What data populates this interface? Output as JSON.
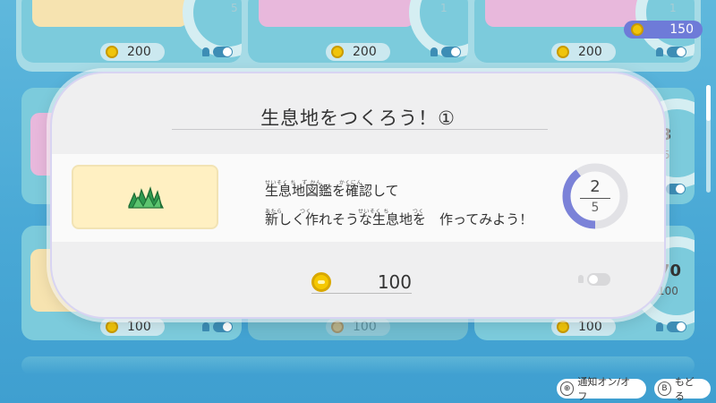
{
  "header": {
    "coin_balance": "150"
  },
  "background_cards": [
    {
      "reward": "200",
      "progress_max": "5"
    },
    {
      "reward": "200",
      "progress_max": "1"
    },
    {
      "reward": "200",
      "progress_max": "1"
    },
    {
      "progress_cur": "3",
      "progress_max": "5"
    },
    {
      "progress_cur": "70",
      "progress_max": "100"
    },
    {
      "reward": "100"
    },
    {
      "reward": "100"
    },
    {
      "reward": "100"
    }
  ],
  "modal": {
    "title": "生息地をつくろう！①",
    "ruby_line1": "せいそく ち　ず かん　　　かくにん",
    "text_line1": "生息地図鑑を確認して",
    "ruby_line2": "あたら　　　つく　　　　　　　　せいそく ち　　　　つく",
    "text_line2": "新しく作れそうな生息地を　作ってみよう！",
    "progress_current": "2",
    "progress_max": "5",
    "progress_fraction": 0.4,
    "reward_value": "100"
  },
  "controls": {
    "notify_button": "⊕",
    "notify_label": "通知オン/オフ",
    "back_button": "B",
    "back_label": "もどる"
  },
  "colors": {
    "background": "#4aa9d6",
    "accent": "#7b82d8",
    "coin": "#f0c40a"
  },
  "icons": [
    "coin-icon",
    "plant-icon",
    "bell-icon",
    "toggle-icon",
    "plus-button-icon",
    "b-button-icon"
  ]
}
